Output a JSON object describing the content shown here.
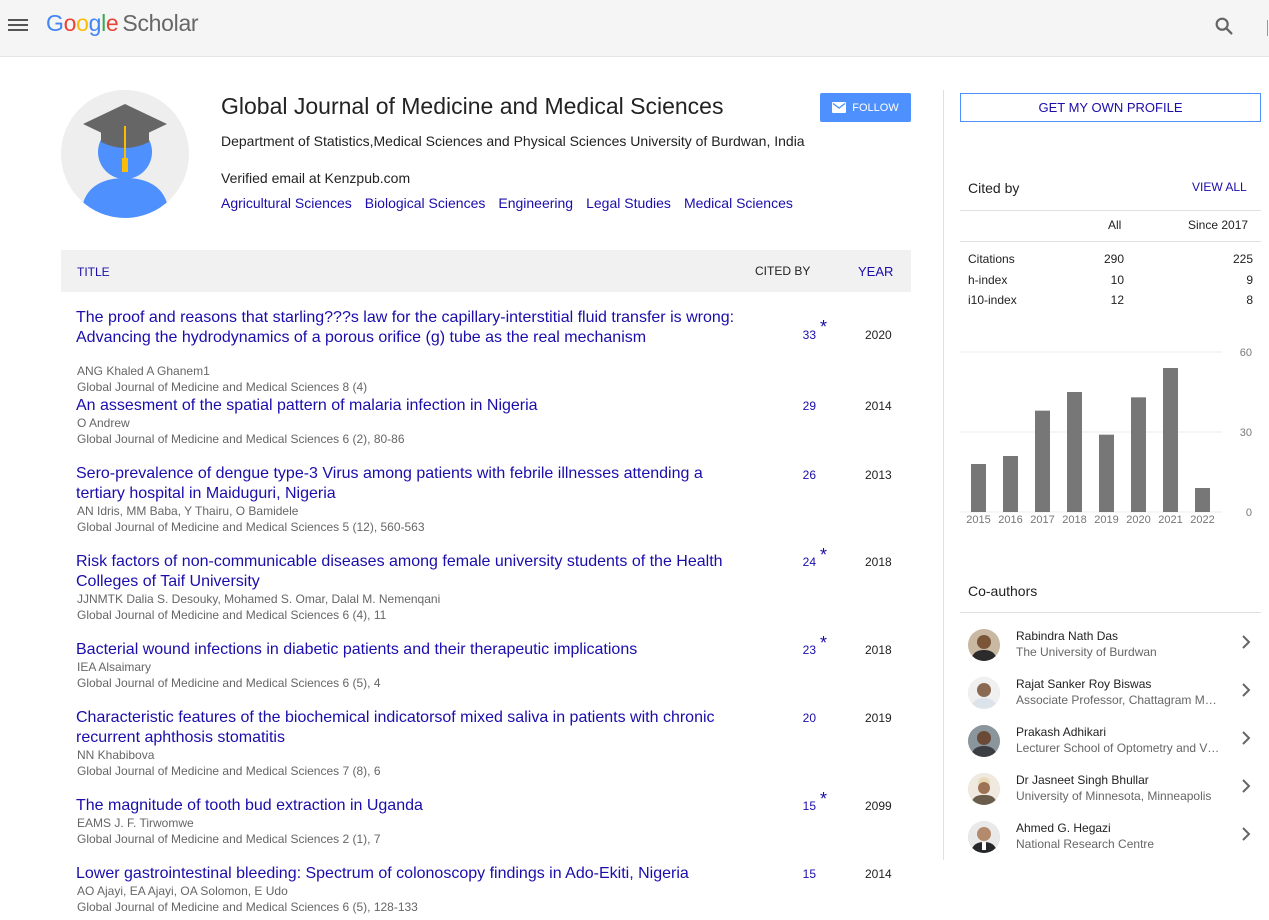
{
  "header": {
    "logo_google": [
      "G",
      "o",
      "o",
      "g",
      "l",
      "e"
    ],
    "logo_scholar": "Scholar",
    "icons": {
      "menu": "hamburger-menu-icon",
      "search": "search-icon"
    }
  },
  "profile": {
    "name": "Global Journal of Medicine and Medical Sciences",
    "affiliation": "Department of Statistics,Medical Sciences and Physical Sciences University of Burdwan, India",
    "verified": "Verified email at Kenzpub.com",
    "interests": [
      "Agricultural Sciences",
      "Biological Sciences",
      "Engineering",
      "Legal Studies",
      "Medical Sciences"
    ],
    "follow_label": "FOLLOW",
    "avatar_icon": "graduate-cap-avatar-icon"
  },
  "table": {
    "col_title": "TITLE",
    "col_cited": "CITED BY",
    "col_year": "YEAR",
    "rows": [
      {
        "title": "The proof and reasons that starling???s law for the capillary-interstitial fluid transfer is wrong: Advancing the hydrodynamics of a porous orifice (g) tube as the real mechanism",
        "authors": "ANG Khaled A Ghanem1",
        "venue": "Global Journal of Medicine and Medical Sciences 8 (4)",
        "cited": "33",
        "star": "*",
        "year": "2020"
      },
      {
        "title": "An assesment of the spatial pattern of malaria infection in Nigeria",
        "authors": "O Andrew",
        "venue": "Global Journal of Medicine and Medical Sciences 6 (2), 80-86",
        "cited": "29",
        "star": "",
        "year": "2014"
      },
      {
        "title": "Sero-prevalence of dengue type-3 Virus among patients with febrile illnesses attending a tertiary hospital in Maiduguri, Nigeria",
        "authors": "AN Idris, MM Baba, Y Thairu, O Bamidele",
        "venue": "Global Journal of Medicine and Medical Sciences 5 (12), 560-563",
        "cited": "26",
        "star": "",
        "year": "2013"
      },
      {
        "title": "Risk factors of non-communicable diseases among female university students of the Health Colleges of Taif University",
        "authors": "JJNMTK Dalia S. Desouky, Mohamed S. Omar, Dalal M. Nemenqani",
        "venue": "Global Journal of Medicine and Medical Sciences 6 (4), 11",
        "cited": "24",
        "star": "*",
        "year": "2018"
      },
      {
        "title": "Bacterial wound infections in diabetic patients and their therapeutic implications",
        "authors": "IEA Alsaimary",
        "venue": "Global Journal of Medicine and Medical Sciences 6 (5), 4",
        "cited": "23",
        "star": "*",
        "year": "2018"
      },
      {
        "title": "Characteristic features of the biochemical indicatorsof mixed saliva in patients with chronic recurrent aphthosis stomatitis",
        "authors": "NN Khabibova",
        "venue": "Global Journal of Medicine and Medical Sciences 7 (8), 6",
        "cited": "20",
        "star": "",
        "year": "2019"
      },
      {
        "title": "The magnitude of tooth bud extraction in Uganda",
        "authors": "EAMS J. F. Tirwomwe",
        "venue": "Global Journal of Medicine and Medical Sciences 2 (1), 7",
        "cited": "15",
        "star": "*",
        "year": "2099"
      },
      {
        "title": "Lower gastrointestinal bleeding: Spectrum of colonoscopy findings in Ado-Ekiti, Nigeria",
        "authors": "AO Ajayi, EA Ajayi, OA Solomon, E Udo",
        "venue": "Global Journal of Medicine and Medical Sciences 6 (5), 128-133",
        "cited": "15",
        "star": "",
        "year": "2014"
      }
    ]
  },
  "sidebar": {
    "get_profile_label": "GET MY OWN PROFILE",
    "cited_by_heading": "Cited by",
    "view_all_label": "VIEW ALL",
    "col_all": "All",
    "col_since": "Since 2017",
    "stats": [
      {
        "label": "Citations",
        "all": "290",
        "since": "225"
      },
      {
        "label": "h-index",
        "all": "10",
        "since": "9"
      },
      {
        "label": "i10-index",
        "all": "12",
        "since": "8"
      }
    ],
    "coauthors_heading": "Co-authors",
    "coauthors": [
      {
        "name": "Rabindra Nath Das",
        "affil": "The University of Burdwan"
      },
      {
        "name": "Rajat Sanker Roy Biswas",
        "affil": "Associate Professor, Chattagram Maa-O-Shishu Hospital Medical College"
      },
      {
        "name": "Prakash Adhikari",
        "affil": "Lecturer School of Optometry and Vision Science"
      },
      {
        "name": "Dr Jasneet Singh Bhullar",
        "affil": "University of Minnesota, Minneapolis"
      },
      {
        "name": "Ahmed G. Hegazi",
        "affil": "National Research Centre"
      }
    ]
  },
  "chart_data": {
    "type": "bar",
    "categories": [
      "2015",
      "2016",
      "2017",
      "2018",
      "2019",
      "2020",
      "2021",
      "2022"
    ],
    "values": [
      18,
      21,
      38,
      45,
      29,
      43,
      54,
      9
    ],
    "ylim": [
      0,
      60
    ],
    "yticks": [
      "60",
      "30",
      "0"
    ],
    "bar_color": "#777777",
    "grid": true
  }
}
